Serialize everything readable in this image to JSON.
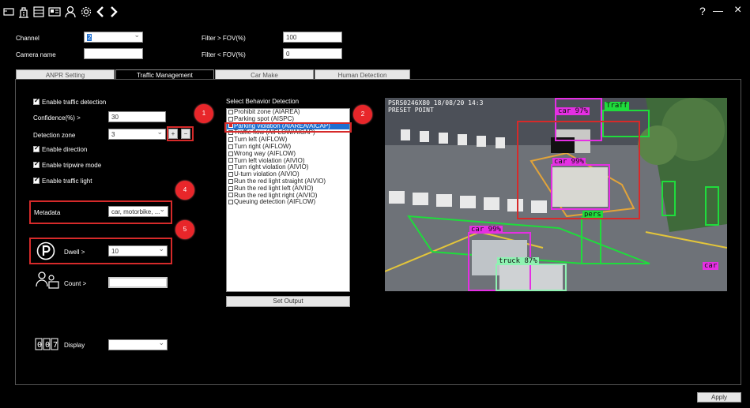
{
  "topbar": {
    "help": "?",
    "minimize": "—",
    "close": "×"
  },
  "filters": {
    "channel_label": "Channel",
    "channel_value": "2",
    "camera_name_label": "Camera name",
    "camera_name_value": "",
    "fov_gt_label": "Filter > FOV(%)",
    "fov_gt_value": "100",
    "fov_lt_label": "Filter < FOV(%)",
    "fov_lt_value": "0"
  },
  "tabs": [
    "ANPR Setting",
    "Traffic Management",
    "Car Make",
    "Human Detection"
  ],
  "traffic": {
    "enable_detection": "Enable traffic detection",
    "confidence_label": "Confidence(%) >",
    "confidence_value": "30",
    "zone_label": "Detection zone",
    "zone_value": "3",
    "add": "+",
    "remove": "−",
    "enable_direction": "Enable direction",
    "enable_tripwire": "Enable tripwire mode",
    "enable_light": "Enable traffic light",
    "metadata_label": "Metadata",
    "metadata_value": "car, motorbike, ...",
    "dwell_label": "Dwell >",
    "dwell_value": "10",
    "count_label": "Count >",
    "count_value": "",
    "display_label": "Display",
    "display_value": ""
  },
  "behavior": {
    "title": "Select Behavior Detection",
    "items": [
      "Prohibit zone (AIAREA)",
      "Parking spot (AISPC)",
      "Parking violation (AIAREA/AICAP)",
      "Traffic flow (AIFLOW/AICAP)",
      "Turn left (AIFLOW)",
      "Turn right (AIFLOW)",
      "Wrong way (AIFLOW)",
      "Turn left violation (AIVIO)",
      "Turn right violation (AIVIO)",
      "U-turn violation (AIVIO)",
      "Run the red light straight (AIVIO)",
      "Run the red light left (AIVIO)",
      "Run the red light right (AIVIO)",
      "Queuing detection (AIFLOW)"
    ],
    "selected_index": 2,
    "set_output": "Set Output"
  },
  "markers": [
    "1",
    "2",
    "3",
    "4",
    "5"
  ],
  "video": {
    "overlay_line1": "PSRS0246X80   18/08/20  14:3",
    "overlay_line2": "PRESET POINT",
    "detections": [
      "car 97%",
      "Traff",
      "car 99%",
      "car 99%",
      "truck 87%",
      "car",
      "pers"
    ]
  },
  "footer": {
    "apply": "Apply"
  },
  "colors": {
    "marker": "#e8262a",
    "highlight": "#d62a2a",
    "selection": "#1e6fd1",
    "det_magenta": "#e52fe3",
    "det_green": "#1fdc3c"
  }
}
